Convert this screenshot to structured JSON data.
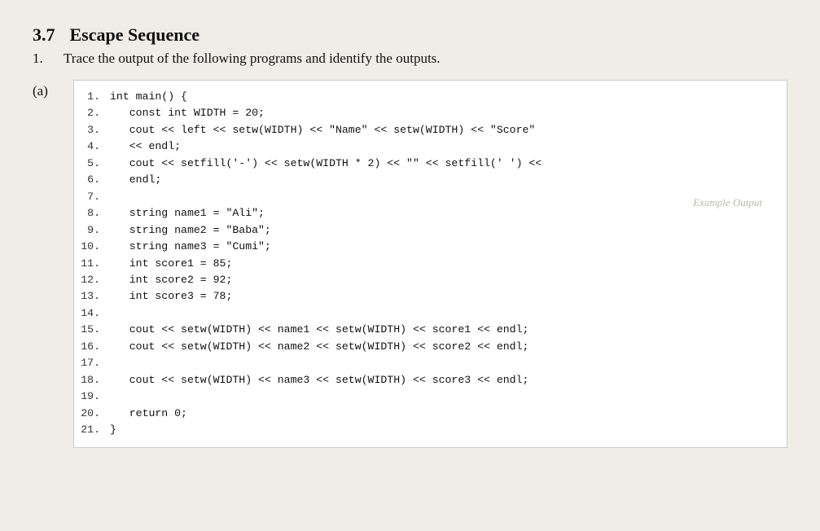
{
  "section": {
    "number": "3.7",
    "title": "Escape Sequence"
  },
  "question": {
    "number": "1.",
    "text": "Trace the output of the following programs and identify the outputs."
  },
  "part_label": "(a)",
  "lines": [
    {
      "num": "1.",
      "code": "int main() {"
    },
    {
      "num": "2.",
      "code": "   const int WIDTH = 20;"
    },
    {
      "num": "3.",
      "code": "   cout << left << setw(WIDTH) << \"Name\" << setw(WIDTH) << \"Score\""
    },
    {
      "num": "4.",
      "code": "   << endl;"
    },
    {
      "num": "5.",
      "code": "   cout << setfill('-') << setw(WIDTH * 2) << \"\" << setfill(' ') <<"
    },
    {
      "num": "6.",
      "code": "   endl;"
    },
    {
      "num": "7.",
      "code": ""
    },
    {
      "num": "8.",
      "code": "   string name1 = \"Ali\";"
    },
    {
      "num": "9.",
      "code": "   string name2 = \"Baba\";"
    },
    {
      "num": "10.",
      "code": "   string name3 = \"Cumi\";"
    },
    {
      "num": "11.",
      "code": "   int score1 = 85;"
    },
    {
      "num": "12.",
      "code": "   int score2 = 92;"
    },
    {
      "num": "13.",
      "code": "   int score3 = 78;"
    },
    {
      "num": "14.",
      "code": ""
    },
    {
      "num": "15.",
      "code": "   cout << setw(WIDTH) << name1 << setw(WIDTH) << score1 << endl;"
    },
    {
      "num": "16.",
      "code": "   cout << setw(WIDTH) << name2 << setw(WIDTH) << score2 << endl;"
    },
    {
      "num": "17.",
      "code": ""
    },
    {
      "num": "18.",
      "code": "   cout << setw(WIDTH) << name3 << setw(WIDTH) << score3 << endl;"
    },
    {
      "num": "19.",
      "code": ""
    },
    {
      "num": "20.",
      "code": "   return 0;"
    },
    {
      "num": "21.",
      "code": "}"
    }
  ],
  "example_output_label": "Example Output"
}
